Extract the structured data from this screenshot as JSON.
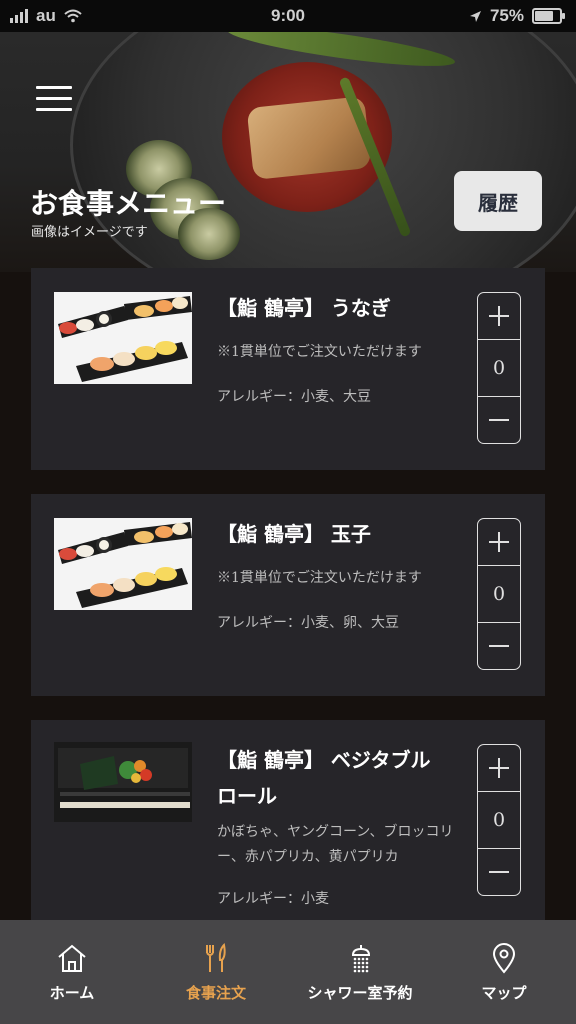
{
  "status_bar": {
    "carrier": "au",
    "time": "9:00",
    "battery_percent": "75%",
    "battery_level": 0.75
  },
  "header": {
    "title": "お食事メニュー",
    "subtitle": "画像はイメージです",
    "history_label": "履歴"
  },
  "menu_items": [
    {
      "title": "【鮨 鶴亭】 うなぎ",
      "description": "※1貫単位でご注文いただけます",
      "allergy": "アレルギー：小麦、大豆",
      "quantity": "0",
      "image": "sushi-platter"
    },
    {
      "title": "【鮨 鶴亭】 玉子",
      "description": "※1貫単位でご注文いただけます",
      "allergy": "アレルギー：小麦、卵、大豆",
      "quantity": "0",
      "image": "sushi-platter"
    },
    {
      "title": "【鮨 鶴亭】 ベジタブルロール",
      "description": "かぼちゃ、ヤングコーン、ブロッコリー、赤パプリカ、黄パプリカ",
      "allergy": "アレルギー：小麦",
      "quantity": "0",
      "image": "vegetable-hand-roll"
    }
  ],
  "bottom_nav": [
    {
      "label": "ホーム",
      "icon": "home-icon",
      "active": false
    },
    {
      "label": "食事注文",
      "icon": "fork-knife-icon",
      "active": true
    },
    {
      "label": "シャワー室予約",
      "icon": "shower-icon",
      "active": false
    },
    {
      "label": "マップ",
      "icon": "map-pin-icon",
      "active": false
    }
  ],
  "colors": {
    "background": "#16110e",
    "card": "#262529",
    "nav_background": "#474648",
    "accent": "#e7a24e",
    "history_button": "#e8e8e8"
  }
}
